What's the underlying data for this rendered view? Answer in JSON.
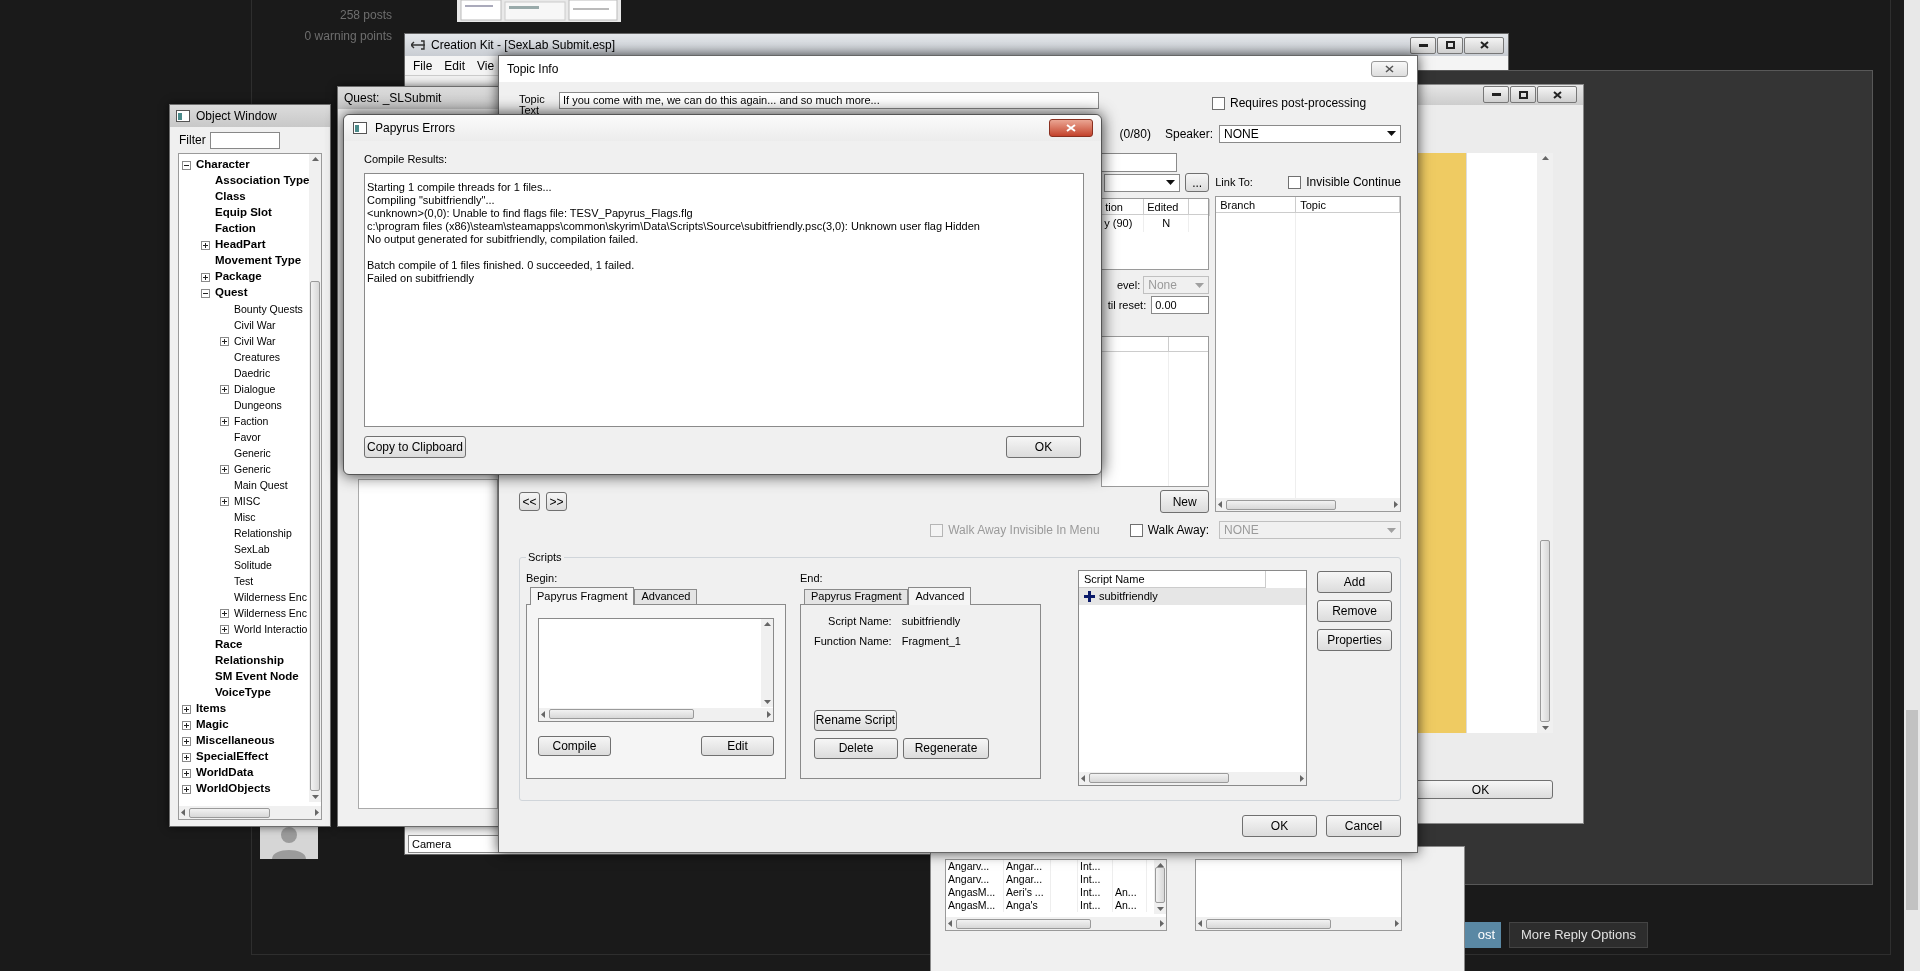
{
  "page": {
    "posts": "258 posts",
    "warnings": "0 warning points",
    "post_button": "ost",
    "more_options_button": "More Reply Options"
  },
  "back_window": {
    "ok_button": "OK"
  },
  "list_window": {
    "rows": [
      {
        "column_1": "Angarv...",
        "column_2": "Angar...",
        "column_4": "Int..."
      },
      {
        "column_1": "Angarv...",
        "column_2": "Angar...",
        "column_4": "Int..."
      },
      {
        "column_1": "AngasM...",
        "column_2": "Aeri's ...",
        "column_4": "Int...",
        "column_5": "An..."
      },
      {
        "column_1": "AngasM...",
        "column_2": "Anga's",
        "column_4": "Int...",
        "column_5": "An..."
      }
    ]
  },
  "object_window": {
    "title": "Object Window",
    "filter_label": "Filter",
    "tree": [
      {
        "label": "Character",
        "expanded": true,
        "children": [
          {
            "label": "Association Type"
          },
          {
            "label": "Class"
          },
          {
            "label": "Equip Slot"
          },
          {
            "label": "Faction"
          },
          {
            "label": "HeadPart",
            "expanded": false
          },
          {
            "label": "Movement Type"
          },
          {
            "label": "Package",
            "expanded": false
          },
          {
            "label": "Quest",
            "expanded": true,
            "children": [
              {
                "label": "Bounty Quests"
              },
              {
                "label": "Civil War"
              },
              {
                "label": "Civil War",
                "expanded": false
              },
              {
                "label": "Creatures"
              },
              {
                "label": "Daedric"
              },
              {
                "label": "Dialogue",
                "expanded": false
              },
              {
                "label": "Dungeons"
              },
              {
                "label": "Faction",
                "expanded": false
              },
              {
                "label": "Favor"
              },
              {
                "label": "Generic"
              },
              {
                "label": "Generic",
                "expanded": false
              },
              {
                "label": "Main Quest"
              },
              {
                "label": "MISC",
                "expanded": false
              },
              {
                "label": "Misc"
              },
              {
                "label": "Relationship"
              },
              {
                "label": "SexLab"
              },
              {
                "label": "Solitude"
              },
              {
                "label": "Test"
              },
              {
                "label": "Wilderness Enc"
              },
              {
                "label": "Wilderness Enc",
                "expanded": false
              },
              {
                "label": "World Interactio",
                "expanded": false
              }
            ]
          },
          {
            "label": "Race"
          },
          {
            "label": "Relationship"
          },
          {
            "label": "SM Event Node"
          },
          {
            "label": "VoiceType"
          }
        ]
      },
      {
        "label": "Items",
        "expanded": false
      },
      {
        "label": "Magic",
        "expanded": false
      },
      {
        "label": "Miscellaneous",
        "expanded": false
      },
      {
        "label": "SpecialEffect",
        "expanded": false
      },
      {
        "label": "WorldData",
        "expanded": false
      },
      {
        "label": "WorldObjects",
        "expanded": false
      }
    ]
  },
  "creation_kit": {
    "title": "Creation Kit - [SexLab Submit.esp]",
    "menu": [
      "File",
      "Edit",
      "Vie"
    ],
    "camera_field": "Camera"
  },
  "quest_window": {
    "title": "Quest: _SLSubmit"
  },
  "topic_info": {
    "title": "Topic Info",
    "topic_text_label": "Topic Text",
    "topic_text": "If you come with me, we can do this again... and so much more...",
    "requires_post_processing": {
      "label": "Requires post-processing",
      "checked": false
    },
    "char_count": "(0/80)",
    "speaker_label": "Speaker:",
    "speaker": "NONE",
    "browse_button": "...",
    "link_to_label": "Link To:",
    "invisible_continue": {
      "label": "Invisible Continue",
      "checked": false
    },
    "responses_table": {
      "columns": [
        "tion",
        "Edited"
      ],
      "rows": [
        [
          "y (90)",
          "N"
        ]
      ]
    },
    "level_label": "evel:",
    "level_value": "None",
    "reset_label": "til reset:",
    "reset_value": "0.00",
    "link_table": {
      "columns": [
        "Branch",
        "Topic"
      ]
    },
    "new_button": "New",
    "prev_button": "<<",
    "next_button": ">>",
    "walk_away_invisible": {
      "label": "Walk Away Invisible In Menu",
      "checked": false,
      "disabled": true
    },
    "walk_away": {
      "label": "Walk Away:",
      "checked": false,
      "disabled": false
    },
    "walk_away_value": "NONE",
    "scripts": {
      "group_label": "Scripts",
      "begin_label": "Begin:",
      "begin_tabs": [
        {
          "label": "Papyrus Fragment",
          "selected": true
        },
        {
          "label": "Advanced",
          "selected": false
        }
      ],
      "compile_button": "Compile",
      "edit_button": "Edit",
      "end_label": "End:",
      "end_tabs": [
        {
          "label": "Papyrus Fragment",
          "selected": false
        },
        {
          "label": "Advanced",
          "selected": true
        }
      ],
      "script_name_label": "Script Name:",
      "script_name": "subitfriendly",
      "function_name_label": "Function Name:",
      "function_name": "Fragment_1",
      "rename_button": "Rename Script",
      "delete_button": "Delete",
      "regenerate_button": "Regenerate",
      "list_header": "Script Name",
      "list_items": [
        {
          "label": "subitfriendly",
          "selected": true
        }
      ],
      "add_button": "Add",
      "remove_button": "Remove",
      "properties_button": "Properties"
    },
    "ok_button": "OK",
    "cancel_button": "Cancel"
  },
  "papyrus_errors": {
    "title": "Papyrus Errors",
    "results_label": "Compile Results:",
    "log_blocks": [
      [
        "Starting 1 compile threads for 1 files...",
        "Compiling \"subitfriendly\"...",
        "<unknown>(0,0): Unable to find flags file: TESV_Papyrus_Flags.flg",
        "c:\\program files (x86)\\steam\\steamapps\\common\\skyrim\\Data\\Scripts\\Source\\subitfriendly.psc(3,0): Unknown user flag Hidden",
        "No output generated for subitfriendly, compilation failed."
      ],
      [
        "Batch compile of 1 files finished. 0 succeeded, 1 failed.",
        "Failed on subitfriendly"
      ]
    ],
    "copy_button": "Copy to Clipboard",
    "ok_button": "OK"
  }
}
